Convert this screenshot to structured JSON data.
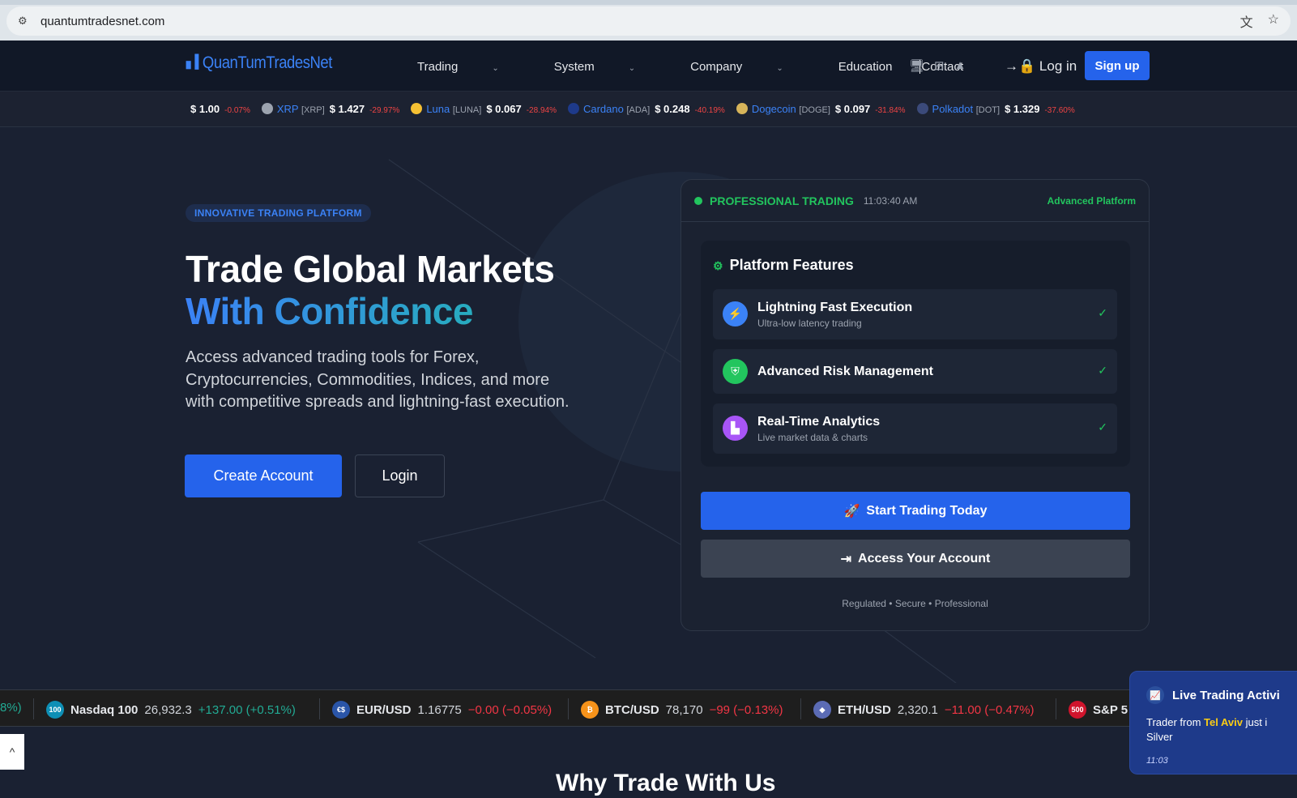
{
  "browser": {
    "url": "quantumtradesnet.com"
  },
  "nav": {
    "logo": "QuanTumTradesNet",
    "menu": [
      {
        "label": "Trading",
        "dropdown": true
      },
      {
        "label": "System",
        "dropdown": true
      },
      {
        "label": "Company",
        "dropdown": true
      },
      {
        "label": "Education",
        "dropdown": false
      },
      {
        "label": "Contact",
        "dropdown": false
      }
    ],
    "login": "Log in",
    "signup": "Sign up"
  },
  "crypto_ticker": [
    {
      "name": "",
      "symbol": "",
      "price": "$ 1.00",
      "change": "-0.07%"
    },
    {
      "name": "XRP",
      "symbol": "[XRP]",
      "price": "$ 1.427",
      "change": "-29.97%",
      "color": "#9ca3af"
    },
    {
      "name": "Luna",
      "symbol": "[LUNA]",
      "price": "$ 0.067",
      "change": "-28.94%",
      "color": "#f5c033"
    },
    {
      "name": "Cardano",
      "symbol": "[ADA]",
      "price": "$ 0.248",
      "change": "-40.19%",
      "color": "#1e3a8a"
    },
    {
      "name": "Dogecoin",
      "symbol": "[DOGE]",
      "price": "$ 0.097",
      "change": "-31.84%",
      "color": "#d6b45a"
    },
    {
      "name": "Polkadot",
      "symbol": "[DOT]",
      "price": "$ 1.329",
      "change": "-37.60%",
      "color": "#3b4a7a"
    }
  ],
  "hero": {
    "badge": "INNOVATIVE TRADING PLATFORM",
    "title_line1": "Trade Global Markets",
    "title_line2": "With Confidence",
    "lead": "Access advanced trading tools for Forex, Cryptocurrencies, Commodities, Indices, and more with competitive spreads and lightning-fast execution.",
    "create_account": "Create Account",
    "login": "Login"
  },
  "card": {
    "status": "PROFESSIONAL TRADING",
    "time": "11:03:40 AM",
    "tag": "Advanced Platform",
    "features_title": "Platform Features",
    "features": [
      {
        "name": "Lightning Fast Execution",
        "sub": "Ultra-low latency trading",
        "color": "#3b82f6",
        "icon": "⚡"
      },
      {
        "name": "Advanced Risk Management",
        "sub": "",
        "color": "#22c55e",
        "icon": "⛨"
      },
      {
        "name": "Real-Time Analytics",
        "sub": "Live market data & charts",
        "color": "#a855f7",
        "icon": "▙"
      }
    ],
    "start": "Start Trading Today",
    "access": "Access Your Account",
    "footer": "Regulated • Secure • Professional"
  },
  "market_ticker": [
    {
      "name": "",
      "value": "",
      "change": "8%)",
      "dir": "up"
    },
    {
      "name": "Nasdaq 100",
      "value": "26,932.3",
      "change": "+137.00 (+0.51%)",
      "dir": "up",
      "icon": "100",
      "color": "#0e8fb5"
    },
    {
      "name": "EUR/USD",
      "value": "1.16775",
      "change": "−0.00 (−0.05%)",
      "dir": "dn",
      "icon": "€$",
      "color": "#2a55a8"
    },
    {
      "name": "BTC/USD",
      "value": "78,170",
      "change": "−99 (−0.13%)",
      "dir": "dn",
      "icon": "₿",
      "color": "#f7931a"
    },
    {
      "name": "ETH/USD",
      "value": "2,320.1",
      "change": "−11.00 (−0.47%)",
      "dir": "dn",
      "icon": "◆",
      "color": "#5b6bb5"
    },
    {
      "name": "S&P 5",
      "value": "",
      "change": "",
      "dir": "dn",
      "icon": "500",
      "color": "#d0142c"
    }
  ],
  "toast": {
    "title": "Live Trading Activi",
    "text_pre": "Trader from ",
    "city": "Tel Aviv",
    "text_post": " just i",
    "line2": "Silver",
    "time": "11:03"
  },
  "section_title": "Why Trade With Us"
}
